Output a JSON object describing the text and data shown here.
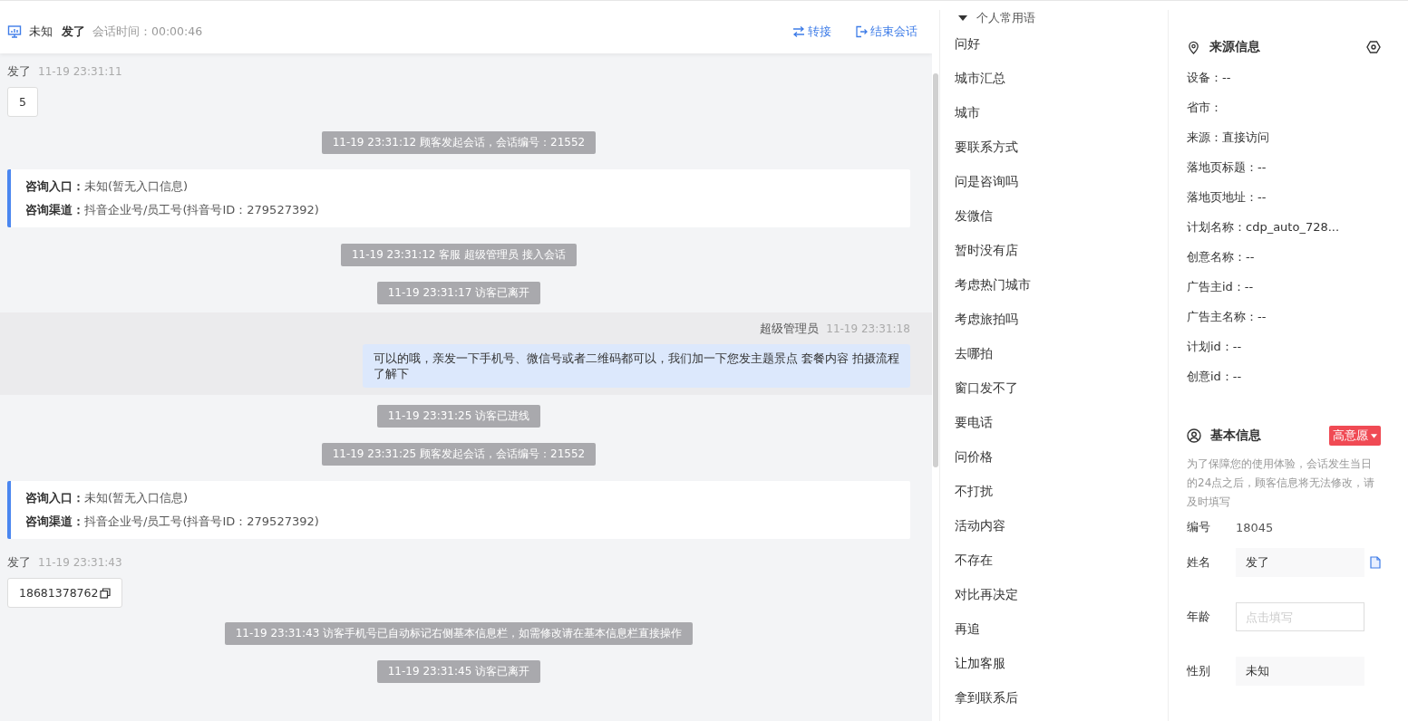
{
  "header": {
    "source": "未知",
    "visitor": "发了",
    "duration": "会话时间：00:00:46",
    "actions": [
      {
        "kind": "transfer",
        "label": "转接"
      },
      {
        "kind": "end",
        "label": "结束会话"
      }
    ]
  },
  "messages": [
    {
      "kind": "visitor",
      "name": "发了",
      "time": "11-19 23:31:11",
      "content": "5",
      "copyable": false
    },
    {
      "kind": "system",
      "text": "11-19 23:31:12 顾客发起会话，会话编号：21552"
    },
    {
      "kind": "entry",
      "rows": [
        {
          "label": "咨询入口：",
          "value": "未知(暂无入口信息)"
        },
        {
          "label": "咨询渠道：",
          "value": "抖音企业号/员工号(抖音号ID：279527392)"
        }
      ]
    },
    {
      "kind": "system",
      "text": "11-19 23:31:12 客服 超级管理员 接入会话"
    },
    {
      "kind": "system",
      "text": "11-19 23:31:17 访客已离开"
    },
    {
      "kind": "agent",
      "name": "超级管理员",
      "time": "11-19 23:31:18",
      "content": "可以的哦，亲发一下手机号、微信号或者二维码都可以，我们加一下您发主题景点 套餐内容 拍摄流程了解下"
    },
    {
      "kind": "system",
      "text": "11-19 23:31:25 访客已进线"
    },
    {
      "kind": "system",
      "text": "11-19 23:31:25 顾客发起会话，会话编号：21552"
    },
    {
      "kind": "entry",
      "rows": [
        {
          "label": "咨询入口：",
          "value": "未知(暂无入口信息)"
        },
        {
          "label": "咨询渠道：",
          "value": "抖音企业号/员工号(抖音号ID：279527392)"
        }
      ]
    },
    {
      "kind": "visitor",
      "name": "发了",
      "time": "11-19 23:31:43",
      "content": "18681378762",
      "copyable": true
    },
    {
      "kind": "system",
      "text": "11-19 23:31:43 访客手机号已自动标记右侧基本信息栏，如需修改请在基本信息栏直接操作"
    },
    {
      "kind": "system",
      "text": "11-19 23:31:45 访客已离开"
    }
  ],
  "phrases": {
    "group": "个人常用语",
    "expanded": true,
    "items": [
      "问好",
      "城市汇总",
      "城市",
      "要联系方式",
      "问是咨询吗",
      "发微信",
      "暂时没有店",
      "考虑热门城市",
      "考虑旅拍吗",
      "去哪拍",
      "窗口发不了",
      "要电话",
      "问价格",
      "不打扰",
      "活动内容",
      "不存在",
      "对比再决定",
      "再追",
      "让加客服",
      "拿到联系后"
    ]
  },
  "source_info": {
    "title": "来源信息",
    "fields": [
      "设备：--",
      "省市：",
      "来源：直接访问",
      "落地页标题：--",
      "落地页地址：--",
      "计划名称：cdp_auto_728...",
      "创意名称：--",
      "广告主id：--",
      "广告主名称：--",
      "计划id：--",
      "创意id：--"
    ]
  },
  "basic_info": {
    "title": "基本信息",
    "intent": "高意愿",
    "notice": "为了保障您的使用体验，会话发生当日的24点之后，顾客信息将无法修改，请及时填写",
    "number_label": "编号",
    "number": "18045",
    "fields": [
      {
        "label": "姓名",
        "value": "发了",
        "copyable": true
      },
      {
        "label": "年龄",
        "placeholder": "点击填写",
        "copyable": false
      },
      {
        "label": "性别",
        "value": "未知",
        "copyable": false
      }
    ]
  }
}
